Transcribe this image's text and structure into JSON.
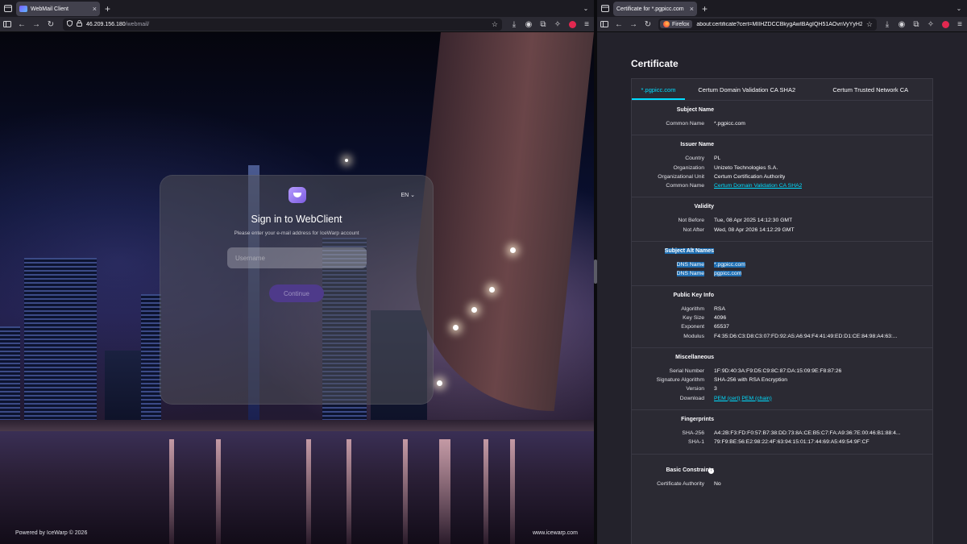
{
  "left_window": {
    "tab_title": "WebMail Client",
    "url_host": "46.209.156.180",
    "url_path": "/webmail/"
  },
  "login": {
    "language": "EN",
    "title": "Sign in to WebClient",
    "subtitle": "Please enter your e-mail address for IceWarp account",
    "username_placeholder": "Username",
    "continue_label": "Continue",
    "footer_left": "Powered by IceWarp © 2026",
    "footer_right": "www.icewarp.com"
  },
  "right_window": {
    "tab_title": "Certificate for *.pgpicc.com",
    "identity_label": "Firefox",
    "url": "about:certificate?cert=MIIHZDCCBkygAwIBAgIQH51AOvnVyYyH2"
  },
  "certificate": {
    "heading": "Certificate",
    "tabs": [
      "*.pgpicc.com",
      "Certum Domain Validation CA SHA2",
      "Certum Trusted Network CA"
    ],
    "subject": {
      "title": "Subject Name",
      "common_name_label": "Common Name",
      "common_name": "*.pgpicc.com"
    },
    "issuer": {
      "title": "Issuer Name",
      "rows": [
        {
          "label": "Country",
          "value": "PL"
        },
        {
          "label": "Organization",
          "value": "Unizeto Technologies S.A."
        },
        {
          "label": "Organizational Unit",
          "value": "Certum Certification Authority"
        }
      ],
      "common_name_label": "Common Name",
      "common_name": "Certum Domain Validation CA SHA2"
    },
    "validity": {
      "title": "Validity",
      "rows": [
        {
          "label": "Not Before",
          "value": "Tue, 08 Apr 2025 14:12:30 GMT"
        },
        {
          "label": "Not After",
          "value": "Wed, 08 Apr 2026 14:12:29 GMT"
        }
      ]
    },
    "alt_names": {
      "title": "Subject Alt Names",
      "rows": [
        {
          "label": "DNS Name",
          "value": "*.pgpicc.com"
        },
        {
          "label": "DNS Name",
          "value": "pgpicc.com"
        }
      ]
    },
    "public_key": {
      "title": "Public Key Info",
      "rows": [
        {
          "label": "Algorithm",
          "value": "RSA"
        },
        {
          "label": "Key Size",
          "value": "4096"
        },
        {
          "label": "Exponent",
          "value": "65537"
        },
        {
          "label": "Modulus",
          "value": "F4:35:D6:C3:D8:C3:07:FD:92:A5:A6:94:F4:41:49:ED:D1:CE:84:98:A4:63:..."
        }
      ]
    },
    "misc": {
      "title": "Miscellaneous",
      "rows": [
        {
          "label": "Serial Number",
          "value": "1F:9D:40:3A:F9:D5:C9:8C:87:DA:15:09:9E:F8:87:26"
        },
        {
          "label": "Signature Algorithm",
          "value": "SHA-256 with RSA Encryption"
        },
        {
          "label": "Version",
          "value": "3"
        }
      ],
      "download_label": "Download",
      "pem_cert": "PEM (cert)",
      "pem_chain": "PEM (chain)"
    },
    "fingerprints": {
      "title": "Fingerprints",
      "rows": [
        {
          "label": "SHA-256",
          "value": "A4:2B:F3:FD:F0:57:B7:38:DD:73:8A:CE:B5:C7:FA:A9:36:7E:00:46:B1:88:4..."
        },
        {
          "label": "SHA-1",
          "value": "79:F9:BE:56:E2:98:22:4F:63:94:15:01:17:44:69:A5:49:54:9F:CF"
        }
      ]
    },
    "basic_constraints": {
      "title": "Basic Constraints",
      "info_glyph": "i",
      "rows": [
        {
          "label": "Certificate Authority",
          "value": "No"
        }
      ]
    }
  }
}
